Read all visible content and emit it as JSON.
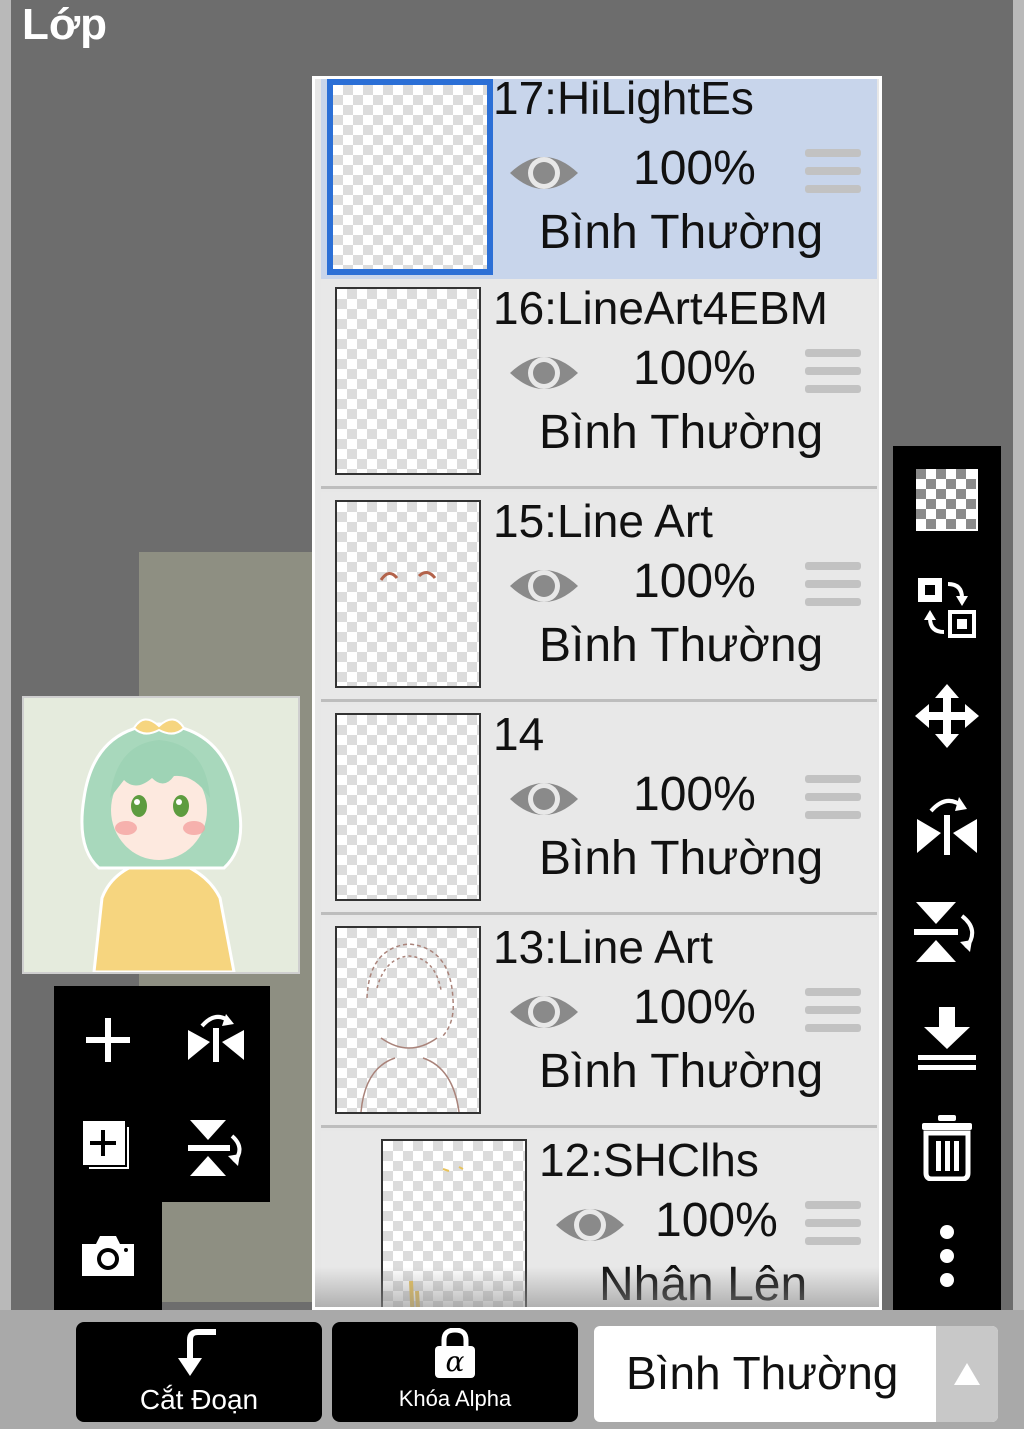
{
  "header": {
    "title": "Lớp"
  },
  "layers": [
    {
      "name": "17:HiLightEs",
      "opacity": "100%",
      "blend": "Bình Thường",
      "selected": true
    },
    {
      "name": "16:LineArt4EBM",
      "opacity": "100%",
      "blend": "Bình Thường",
      "selected": false
    },
    {
      "name": "15:Line Art",
      "opacity": "100%",
      "blend": "Bình Thường",
      "selected": false
    },
    {
      "name": "14",
      "opacity": "100%",
      "blend": "Bình Thường",
      "selected": false
    },
    {
      "name": "13:Line Art",
      "opacity": "100%",
      "blend": "Bình Thường",
      "selected": false
    },
    {
      "name": "12:SHClhs",
      "opacity": "100%",
      "blend": "Nhân Lên",
      "selected": false
    }
  ],
  "left_tools": [
    "add-layer-icon",
    "flip-horizontal-icon",
    "add-copy-layer-icon",
    "flip-vertical-icon",
    "camera-icon"
  ],
  "right_tools": [
    "transparency-icon",
    "swap-layers-icon",
    "move-icon",
    "flip-horizontal-icon",
    "flip-vertical-icon",
    "merge-down-icon",
    "trash-icon",
    "more-icon"
  ],
  "bottom_bar": {
    "clipping_label": "Cắt Đoạn",
    "alpha_lock_label": "Khóa Alpha",
    "alpha_symbol": "α",
    "blend_mode_value": "Bình Thường"
  },
  "colors": {
    "selected_row": "#c8d5eb",
    "selected_border": "#2b6fd6",
    "toolbar": "#000000",
    "background": "#6d6d6d"
  }
}
